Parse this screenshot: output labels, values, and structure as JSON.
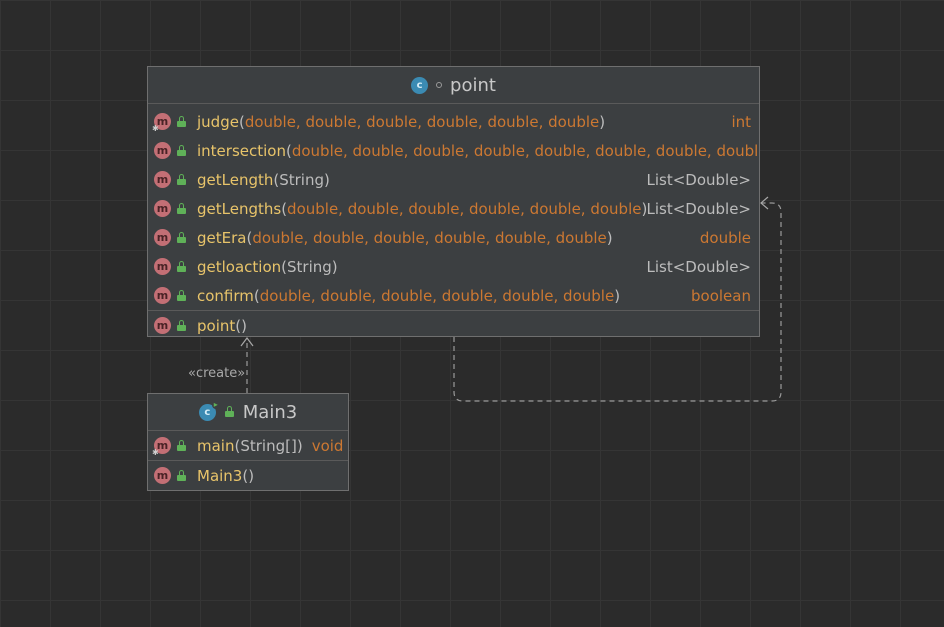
{
  "classes": {
    "point": {
      "name": "point",
      "methods": [
        {
          "name": "judge",
          "params": "double, double, double, double, double, double",
          "returns": "int",
          "static": true
        },
        {
          "name": "intersection",
          "params": "double, double, double, double, double, double, double, double",
          "returns": "",
          "static": false
        },
        {
          "name": "getLength",
          "params": "String",
          "returns": "List<Double>",
          "static": false
        },
        {
          "name": "getLengths",
          "params": "double, double, double, double, double, double",
          "returns": "List<Double>",
          "static": false
        },
        {
          "name": "getEra",
          "params": "double, double, double, double, double, double",
          "returns": "double",
          "static": false
        },
        {
          "name": "getloaction",
          "params": "String",
          "returns": "List<Double>",
          "static": false
        },
        {
          "name": "confirm",
          "params": "double, double, double, double, double, double",
          "returns": "boolean",
          "static": false
        }
      ],
      "constructors": [
        {
          "name": "point",
          "params": ""
        }
      ]
    },
    "main3": {
      "name": "Main3",
      "methods": [
        {
          "name": "main",
          "params": "String[]",
          "returns": "void",
          "static": true
        }
      ],
      "constructors": [
        {
          "name": "Main3",
          "params": ""
        }
      ]
    }
  },
  "relations": {
    "create_label": "«create»"
  },
  "icons": {
    "class": "class-icon",
    "method": "method-icon",
    "visibility": "public-lock-icon",
    "package": "package-dot-icon"
  },
  "colors": {
    "background": "#2b2b2b",
    "box": "#3c3f41",
    "method_name": "#e8c46a",
    "keyword_type": "#cc7832",
    "text": "#bcbcbc"
  }
}
